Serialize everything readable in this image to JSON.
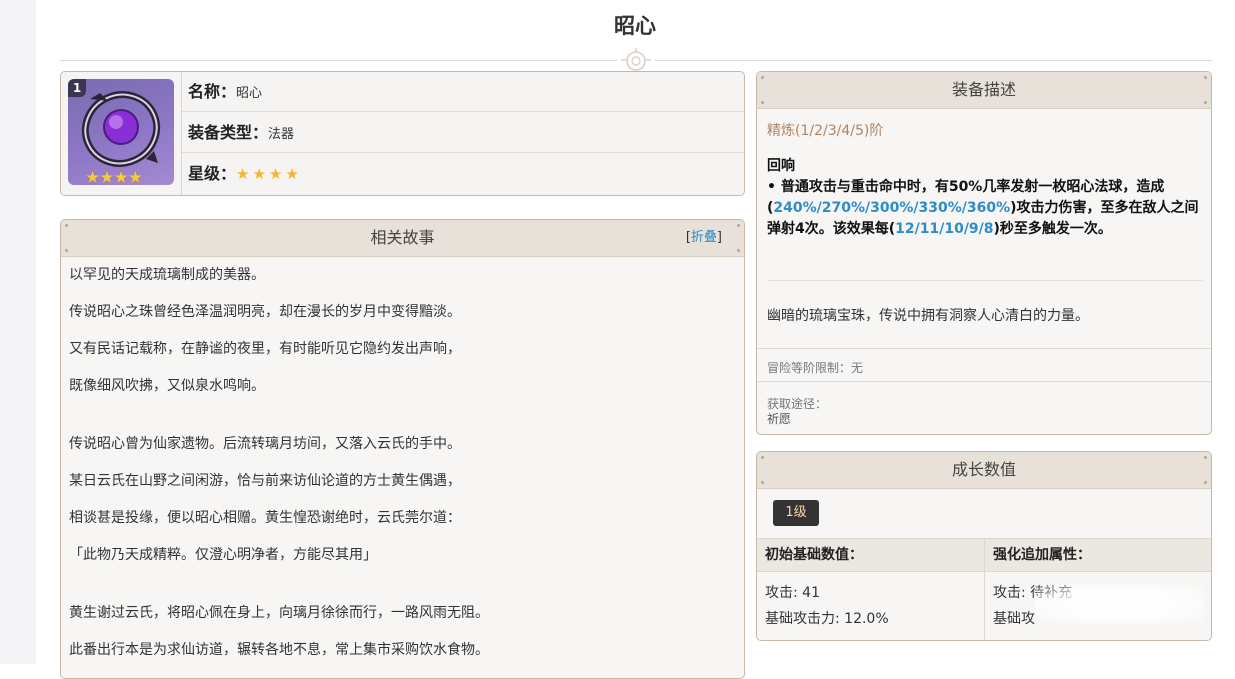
{
  "page": {
    "title": "昭心"
  },
  "weapon": {
    "level_badge": "1",
    "icon_stars": "★★★★",
    "name_label": "名称：",
    "name_value": "昭心",
    "type_label": "装备类型：",
    "type_value": "法器",
    "rarity_label": "星级：",
    "rarity_stars": 4
  },
  "story": {
    "header": "相关故事",
    "fold_bracket_open": "[",
    "fold_label": "折叠",
    "fold_bracket_close": "]",
    "lines": [
      "以罕见的天成琉璃制成的美器。",
      "传说昭心之珠曾经色泽温润明亮，却在漫长的岁月中变得黯淡。",
      "又有民话记载称，在静谧的夜里，有时能听见它隐约发出声响，",
      "既像细风吹拂，又似泉水鸣响。",
      "",
      "传说昭心曾为仙家遗物。后流转璃月坊间，又落入云氏的手中。",
      "某日云氏在山野之间闲游，恰与前来访仙论道的方士黄生偶遇，",
      "相谈甚是投缘，便以昭心相赠。黄生惶恐谢绝时，云氏莞尔道：",
      "「此物乃天成精粹。仅澄心明净者，方能尽其用」",
      "",
      "黄生谢过云氏，将昭心佩在身上，向璃月徐徐而行，一路风雨无阻。",
      "此番出行本是为求仙访道，辗转各地不息，常上集市采购饮水食物。"
    ]
  },
  "description": {
    "header": "装备描述",
    "refine": "精炼(1/2/3/4/5)阶",
    "effect_title": "回响",
    "effect_p1": "• 普通攻击与重击命中时，有50%几率发射一枚昭心法球，造成(",
    "effect_hl1": "240%/270%/300%/330%/360%",
    "effect_p2": ")攻击力伤害，至多在敌人之间弹射4次。该效果每(",
    "effect_hl2": "12/11/10/9/8",
    "effect_p3": ")秒至多触发一次。",
    "flavor": "幽暗的琉璃宝珠，传说中拥有洞察人心清白的力量。",
    "rank_limit": "冒险等阶限制：无",
    "source_label": "获取途径：",
    "source_value": "祈愿"
  },
  "stats": {
    "header": "成长数值",
    "level_button": "1级",
    "base_header": "初始基础数值：",
    "bonus_header": "强化追加属性：",
    "base_attack": "攻击: 41",
    "base_sub": "基础攻击力: 12.0%",
    "bonus_attack": "攻击: 待补充",
    "bonus_sub": "基础攻"
  },
  "colors": {
    "accent_blue": "#2c8dc9",
    "refine_brown": "#b08563",
    "star_gold": "#f2b72c",
    "panel_border": "#c8b9a6",
    "panel_header_bg": "#e7e1d9"
  }
}
